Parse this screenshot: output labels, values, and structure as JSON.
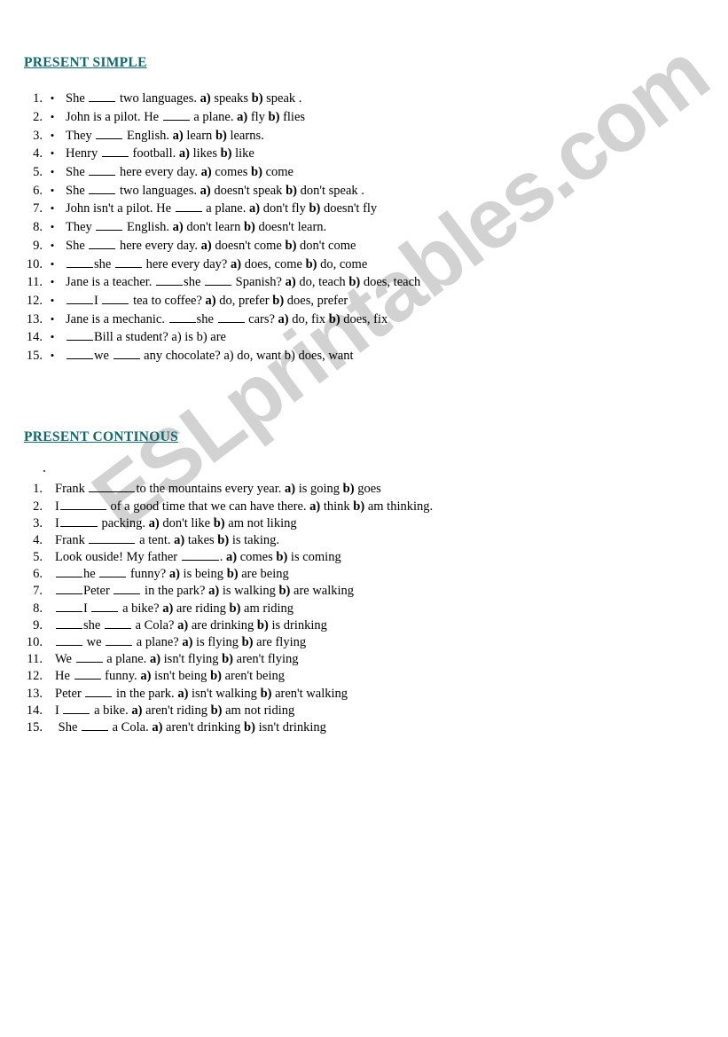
{
  "watermark": {
    "text": "ESLprintables.com",
    "color": "#d2d2d2"
  },
  "theme": {
    "heading_color": "#10696b",
    "text_color": "#000000",
    "page_background": "#ffffff"
  },
  "sections": [
    {
      "id": "present-simple",
      "heading": "PRESENT SIMPLE",
      "has_bullets": true,
      "bullet_glyph": "•",
      "items": [
        {
          "num": "1.",
          "pre": "She ",
          "blank1": "md",
          "mid": " two languages. ",
          "a_label": "a)",
          "a_text": " speaks ",
          "b_label": "b)",
          "b_text": " speak .",
          "bold_markers": true
        },
        {
          "num": "2.",
          "pre": "John is a pilot. He ",
          "blank1": "md",
          "mid": " a plane. ",
          "a_label": "a)",
          "a_text": " fly ",
          "b_label": "b)",
          "b_text": " flies",
          "bold_markers": true
        },
        {
          "num": "3.",
          "pre": "They ",
          "blank1": "md",
          "mid": " English. ",
          "a_label": "a)",
          "a_text": " learn ",
          "b_label": "b)",
          "b_text": " learns.",
          "bold_markers": true
        },
        {
          "num": "4.",
          "pre": "Henry ",
          "blank1": "md",
          "mid": " football. ",
          "a_label": "a)",
          "a_text": " likes ",
          "b_label": "b)",
          "b_text": " like",
          "bold_markers": true
        },
        {
          "num": "5.",
          "pre": "She ",
          "blank1": "md",
          "mid": " here every day. ",
          "a_label": "a)",
          "a_text": " comes ",
          "b_label": "b)",
          "b_text": " come",
          "bold_markers": true
        },
        {
          "num": "6.",
          "pre": "She ",
          "blank1": "md",
          "mid": " two languages. ",
          "a_label": "a)",
          "a_text": " doesn't speak ",
          "b_label": "b)",
          "b_text": " don't speak .",
          "bold_markers": true
        },
        {
          "num": "7.",
          "pre": "John isn't a pilot. He ",
          "blank1": "md",
          "mid": " a plane. ",
          "a_label": "a)",
          "a_text": " don't fly ",
          "b_label": "b)",
          "b_text": " doesn't fly",
          "bold_markers": true
        },
        {
          "num": "8.",
          "pre": "They ",
          "blank1": "md",
          "mid": " English. ",
          "a_label": "a)",
          "a_text": " don't learn ",
          "b_label": "b)",
          "b_text": " doesn't learn.",
          "bold_markers": true
        },
        {
          "num": "9.",
          "pre": "She ",
          "blank1": "md",
          "mid": " here every day. ",
          "a_label": "a)",
          "a_text": " doesn't come ",
          "b_label": "b)",
          "b_text": " don't come",
          "bold_markers": true
        },
        {
          "num": "10.",
          "pre": "",
          "blank1": "md",
          "mid": "she ",
          "blank2": "md",
          "post": " here every day? ",
          "a_label": "a)",
          "a_text": " does, come ",
          "b_label": "b)",
          "b_text": " do, come",
          "bold_markers": true
        },
        {
          "num": "11.",
          "pre": "Jane is a teacher. ",
          "blank1": "md",
          "mid": "she ",
          "blank2": "md",
          "post": " Spanish? ",
          "a_label": "a)",
          "a_text": " do, teach ",
          "b_label": "b)",
          "b_text": " does, teach",
          "bold_markers": true
        },
        {
          "num": "12.",
          "pre": "",
          "blank1": "md",
          "mid": "I ",
          "blank2": "md",
          "post": " tea to coffee? ",
          "a_label": "a)",
          "a_text": " do, prefer ",
          "b_label": "b)",
          "b_text": " does, prefer",
          "bold_markers": true
        },
        {
          "num": "13.",
          "pre": "Jane is a mechanic. ",
          "blank1": "md",
          "mid": "she ",
          "blank2": "md",
          "post": " cars? ",
          "a_label": "a)",
          "a_text": " do, fix ",
          "b_label": "b)",
          "b_text": " does, fix",
          "bold_markers": true
        },
        {
          "num": "14.",
          "pre": "",
          "blank1": "md",
          "mid": "Bill a student? ",
          "a_label": "a)",
          "a_text": " is ",
          "b_label": "b)",
          "b_text": " are",
          "bold_markers": false
        },
        {
          "num": "15.",
          "pre": "",
          "blank1": "md",
          "mid": "we ",
          "blank2": "md",
          "post": " any chocolate? ",
          "a_label": "a)",
          "a_text": " do, want ",
          "b_label": "b)",
          "b_text": " does, want",
          "bold_markers": false
        }
      ]
    },
    {
      "id": "present-continous",
      "heading": "PRESENT CONTINOUS",
      "has_bullets": false,
      "bullet_glyph": "",
      "items": [
        {
          "num": "1.",
          "pre": "Frank ",
          "blank1": "xl",
          "mid": "to the mountains every year. ",
          "a_label": "a)",
          "a_text": " is going ",
          "b_label": "b)",
          "b_text": " goes",
          "bold_markers": true
        },
        {
          "num": "2.",
          "pre": "I",
          "blank1": "xl",
          "mid": " of a good time that we can have there. ",
          "a_label": "a)",
          "a_text": " think ",
          "b_label": "b)",
          "b_text": " am thinking.",
          "bold_markers": true
        },
        {
          "num": "3.",
          "pre": "I",
          "blank1": "lg",
          "mid": " packing. ",
          "a_label": "a)",
          "a_text": " don't like ",
          "b_label": "b)",
          "b_text": " am not liking",
          "bold_markers": true
        },
        {
          "num": "4.",
          "pre": "Frank ",
          "blank1": "xl",
          "mid": " a tent. ",
          "a_label": "a)",
          "a_text": " takes ",
          "b_label": "b)",
          "b_text": " is taking.",
          "bold_markers": true
        },
        {
          "num": "5.",
          "pre": "Look ouside! My father ",
          "blank1": "lg",
          "mid": ". ",
          "a_label": "a)",
          "a_text": " comes ",
          "b_label": "b)",
          "b_text": " is coming",
          "bold_markers": true
        },
        {
          "num": "6.",
          "pre": "",
          "blank1": "md",
          "mid": "he ",
          "blank2": "md",
          "post": " funny? ",
          "a_label": "a)",
          "a_text": " is being ",
          "b_label": "b)",
          "b_text": " are being",
          "bold_markers": true
        },
        {
          "num": "7.",
          "pre": "",
          "blank1": "md",
          "mid": "Peter ",
          "blank2": "md",
          "post": " in the park? ",
          "a_label": "a)",
          "a_text": " is walking ",
          "b_label": "b)",
          "b_text": " are walking",
          "bold_markers": true
        },
        {
          "num": "8.",
          "pre": "",
          "blank1": "md",
          "mid": "I ",
          "blank2": "md",
          "post": " a bike? ",
          "a_label": "a)",
          "a_text": " are riding ",
          "b_label": "b)",
          "b_text": " am riding",
          "bold_markers": true
        },
        {
          "num": "9.",
          "pre": "",
          "blank1": "md",
          "mid": "she ",
          "blank2": "md",
          "post": " a Cola? ",
          "a_label": "a)",
          "a_text": " are drinking ",
          "b_label": "b)",
          "b_text": " is drinking",
          "bold_markers": true
        },
        {
          "num": "10.",
          "pre": "",
          "blank1": "md",
          "mid": " we ",
          "blank2": "md",
          "post": " a plane? ",
          "a_label": "a)",
          "a_text": " is flying ",
          "b_label": "b)",
          "b_text": " are flying",
          "bold_markers": true
        },
        {
          "num": "11.",
          "pre": "We ",
          "blank1": "md",
          "mid": " a plane. ",
          "a_label": "a)",
          "a_text": " isn't flying ",
          "b_label": "b)",
          "b_text": " aren't flying",
          "bold_markers": true
        },
        {
          "num": "12.",
          "pre": "He ",
          "blank1": "md",
          "mid": " funny. ",
          "a_label": "a)",
          "a_text": " isn't being ",
          "b_label": "b)",
          "b_text": " aren't being",
          "bold_markers": true
        },
        {
          "num": "13.",
          "pre": "Peter ",
          "blank1": "md",
          "mid": " in the park. ",
          "a_label": "a)",
          "a_text": " isn't walking ",
          "b_label": "b)",
          "b_text": " aren't walking",
          "bold_markers": true
        },
        {
          "num": "14.",
          "pre": "I ",
          "blank1": "md",
          "mid": " a bike. ",
          "a_label": "a)",
          "a_text": " aren't riding ",
          "b_label": "b)",
          "b_text": " am not riding",
          "bold_markers": true
        },
        {
          "num": "15.",
          "pre": " She ",
          "blank1": "md",
          "mid": " a Cola. ",
          "a_label": "a)",
          "a_text": " aren't drinking ",
          "b_label": "b)",
          "b_text": " isn't drinking",
          "bold_markers": true
        }
      ]
    }
  ]
}
